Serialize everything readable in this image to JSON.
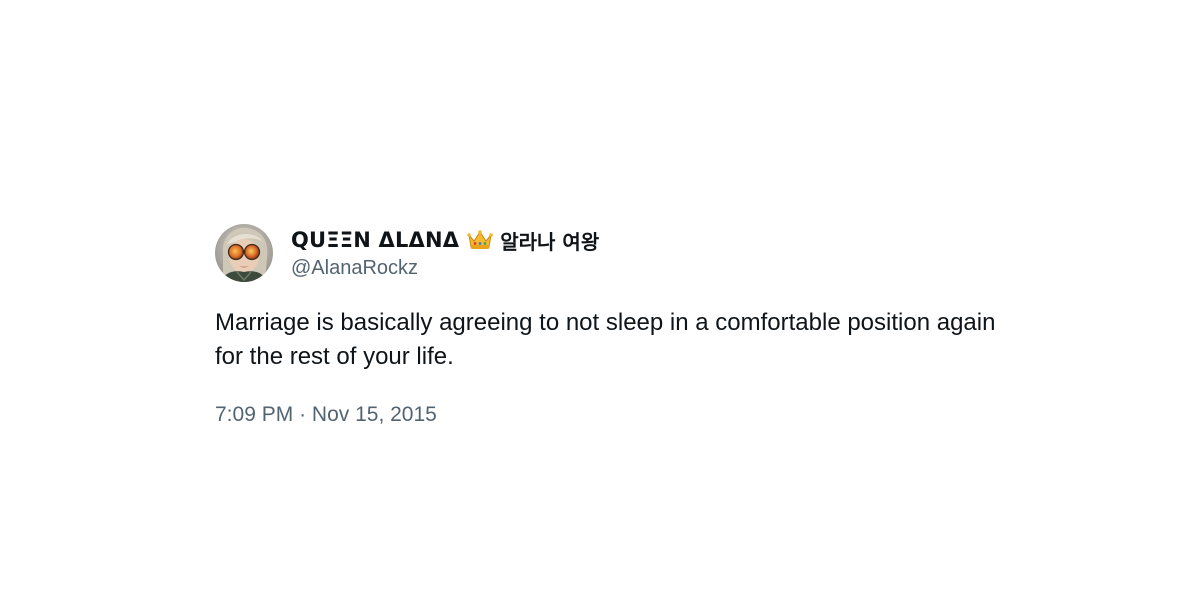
{
  "tweet": {
    "display_name": "QUΞΞN ΔLΔNΔ",
    "crown_icon": "crown-icon",
    "korean_name": "알라나 여왕",
    "handle": "@AlanaRockz",
    "text": "Marriage is basically agreeing to not sleep in a comfortable position again for the rest of your life.",
    "time": "7:09 PM",
    "separator": "·",
    "date": "Nov 15, 2015"
  },
  "colors": {
    "primary_text": "#0f1419",
    "secondary_text": "#536471",
    "background": "#ffffff"
  }
}
